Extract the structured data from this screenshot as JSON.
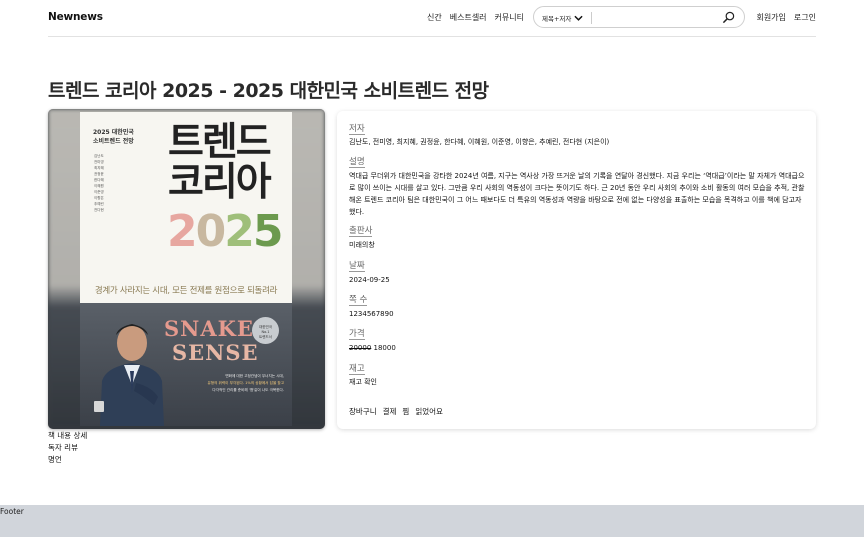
{
  "header": {
    "logo": "Newnews",
    "nav": [
      "신간",
      "베스트셀러",
      "커뮤니티"
    ],
    "search": {
      "category": "제목+저자",
      "placeholder": ""
    },
    "auth": [
      "회원가입",
      "로그인"
    ]
  },
  "book": {
    "title": "트렌드 코리아 2025 - 2025 대한민국 소비트렌드 전망",
    "fields": {
      "author_label": "저자",
      "author": "김난도, 전미영, 최지혜, 권정윤, 한다혜, 이혜원, 이준영, 이향은, 추예린, 전다현 (지은이)",
      "description_label": "설명",
      "description": "역대급 무더위가 대한민국을 강타한 2024년 여름, 지구는 역사상 가장 뜨거운 날의 기록을 연달아 경신했다. 지금 우리는 ‘역대급’이라는 말 자체가 역대급으로 많이 쓰이는 시대를 살고 있다. 그만큼 우리 사회의 역동성이 크다는 뜻이기도 하다. 근 20년 동안 우리 사회의 추이와 소비 활동의 여러 모습을 추적, 관찰해온 트렌드 코리아 팀은 대한민국이 그 어느 때보다도 더 특유의 역동성과 역량을 바탕으로 전에 없는 다양성을 표출하는 모습을 목격하고 이를 책에 담고자 했다.",
      "publisher_label": "출판사",
      "publisher": "미래의창",
      "date_label": "날짜",
      "date": "2024-09-25",
      "pages_label": "쪽 수",
      "pages": "1234567890",
      "price_label": "가격",
      "price_original": "20000",
      "price_sale": "18000",
      "stock_label": "재고",
      "stock": "재고 확인"
    },
    "actions": [
      "장바구니",
      "결제",
      "찜",
      "읽었어요"
    ],
    "cover": {
      "small_title": "2025 대한민국\n소비트렌드 전망",
      "names": "김난도\n전미영\n최지혜\n권정윤\n한다혜\n이혜원\n이준영\n이향은\n추예린\n전다현",
      "big_line1": "트렌드",
      "big_line2": "코리아",
      "year_digits": [
        "2",
        "0",
        "2",
        "5"
      ],
      "slogan": "경계가 사라지는 시대, 모든 전제를 원점으로 되돌려라",
      "snake_line1": "SNAKE",
      "snake_line2": "SENSE",
      "badge": "대한민국\nNo.1\n트렌드서",
      "blurb_line1": "변화에 대한 고정관념이 무너지는 시대,",
      "blurb_hl": "유형의 위력이 부각된다. 1%의 상황에서 답을 찾고",
      "blurb_line3": "다각적인 관리를 준비해 '뱀'같이 나도 극복한다."
    }
  },
  "below_links": [
    "책 내용 상세",
    "독자 리뷰",
    "명언"
  ],
  "footer": {
    "label": "Footer"
  },
  "colors": {
    "footer_bg": "#d1d5db",
    "card_shadow": "rgba(0,0,0,0.14)"
  }
}
